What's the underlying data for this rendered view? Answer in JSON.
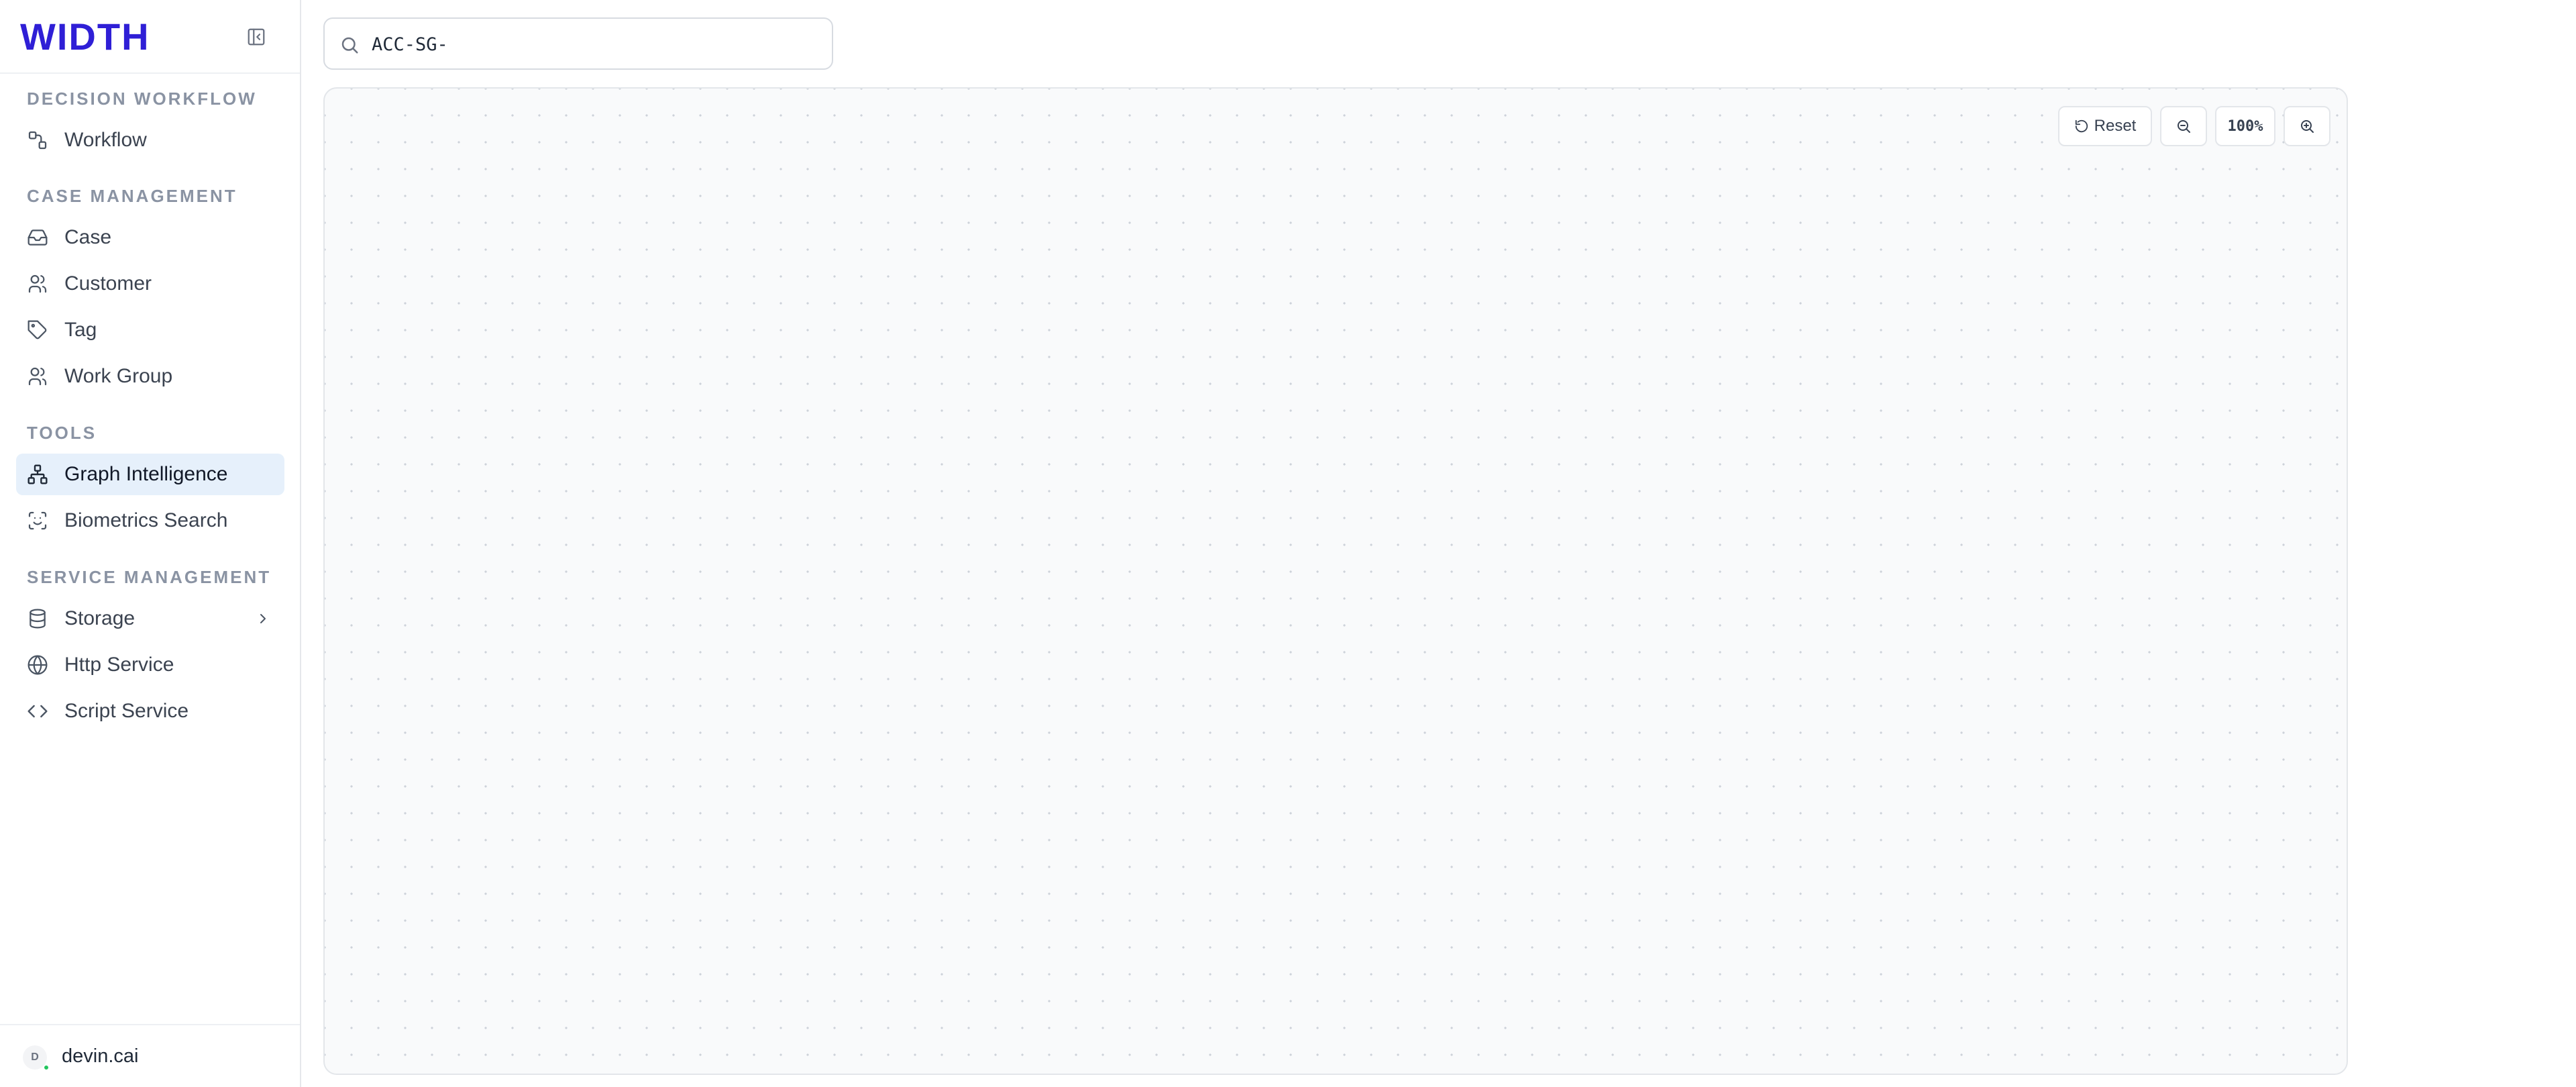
{
  "app": {
    "brand": "WIDTH",
    "brand_color": "#2f1fd6"
  },
  "sidebar": {
    "sections": [
      {
        "label": "DECISION WORKFLOW"
      },
      {
        "label": "CASE MANAGEMENT"
      },
      {
        "label": "TOOLS"
      },
      {
        "label": "SERVICE MANAGEMENT"
      }
    ],
    "items": [
      {
        "label": "Workflow",
        "icon": "workflow-icon"
      },
      {
        "label": "Case",
        "icon": "inbox-icon"
      },
      {
        "label": "Customer",
        "icon": "users-icon"
      },
      {
        "label": "Tag",
        "icon": "tag-icon"
      },
      {
        "label": "Work Group",
        "icon": "users-icon"
      },
      {
        "label": "Graph Intelligence",
        "icon": "network-icon",
        "active": true
      },
      {
        "label": "Biometrics Search",
        "icon": "face-scan-icon"
      },
      {
        "label": "Storage",
        "icon": "database-icon",
        "has_submenu": true
      },
      {
        "label": "Http Service",
        "icon": "globe-icon"
      },
      {
        "label": "Script Service",
        "icon": "code-icon"
      }
    ],
    "user": {
      "initial": "D",
      "name": "devin.cai",
      "status_color": "#22c55e"
    },
    "active_bg": "#e6f0fb"
  },
  "search": {
    "value": "ACC-SG-"
  },
  "canvas": {
    "reset_label": "Reset",
    "zoom_label": "100%"
  }
}
